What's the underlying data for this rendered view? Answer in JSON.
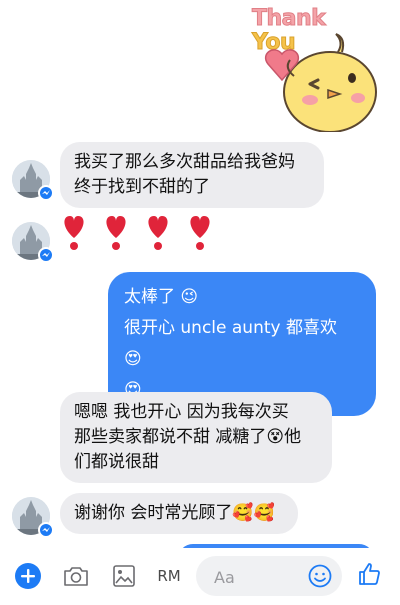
{
  "sticker": {
    "line1": "Thank",
    "line2": "You"
  },
  "messages": {
    "m1": {
      "line1": "我买了那么多次甜品给我爸妈",
      "line2": "终于找到不甜的了"
    },
    "m2": {
      "hearts": [
        "❤️",
        "❤️",
        "❤️",
        "❤️"
      ]
    },
    "m3": {
      "line1": "太棒了 😉",
      "line2": "很开心 uncle aunty 都喜欢 😍",
      "line3": "😍"
    },
    "m4": {
      "line1": "嗯嗯 我也开心 因为我每次买",
      "line2": "那些卖家都说不甜 减糖了😵他",
      "line3": "们都说很甜"
    },
    "m5": {
      "text": "谢谢你 会时常光顾了🥰🥰"
    }
  },
  "toolbar": {
    "rm_label": "RM",
    "input_placeholder": "Aa",
    "icons": [
      "plus-icon",
      "camera-icon",
      "image-icon",
      "emoji-icon",
      "thumbs-up-icon"
    ],
    "accent": "#1d7bf5"
  },
  "colors": {
    "incoming_bubble": "#ececef",
    "outgoing_bubble": "#3b87f6"
  }
}
